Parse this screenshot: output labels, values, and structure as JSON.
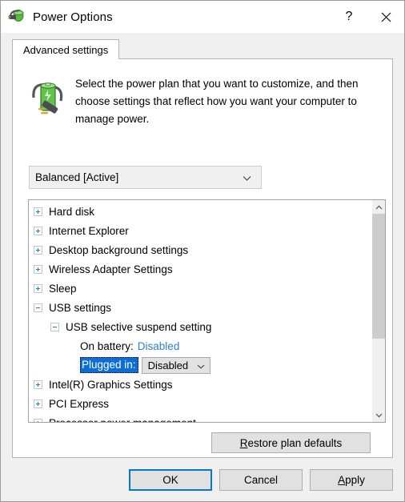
{
  "window": {
    "title": "Power Options",
    "icon": "power-battery-plug-icon",
    "help_label": "?",
    "close_label": "✕"
  },
  "tabs": [
    {
      "label": "Advanced settings",
      "selected": true
    }
  ],
  "header": {
    "icon": "battery-plug-icon",
    "description": "Select the power plan that you want to customize, and then choose settings that reflect how you want your computer to manage power."
  },
  "plan_select": {
    "value": "Balanced [Active]",
    "chevron": "chevron-down-icon"
  },
  "settings_tree": [
    {
      "level": 0,
      "expander": "plus",
      "label": "Hard disk"
    },
    {
      "level": 0,
      "expander": "plus",
      "label": "Internet Explorer"
    },
    {
      "level": 0,
      "expander": "plus",
      "label": "Desktop background settings"
    },
    {
      "level": 0,
      "expander": "plus",
      "label": "Wireless Adapter Settings"
    },
    {
      "level": 0,
      "expander": "plus",
      "label": "Sleep"
    },
    {
      "level": 0,
      "expander": "minus",
      "label": "USB settings"
    },
    {
      "level": 1,
      "expander": "minus",
      "label": "USB selective suspend setting"
    },
    {
      "level": 2,
      "expander": "none",
      "label": "On battery:",
      "value": "Disabled",
      "value_style": "link"
    },
    {
      "level": 2,
      "expander": "none",
      "label": "Plugged in:",
      "value": "Disabled",
      "value_style": "combo",
      "selected": true
    },
    {
      "level": 0,
      "expander": "plus",
      "label": "Intel(R) Graphics Settings"
    },
    {
      "level": 0,
      "expander": "plus",
      "label": "PCI Express"
    },
    {
      "level": 0,
      "expander": "plus",
      "label": "Processor power management"
    }
  ],
  "scrollbar": {
    "up_arrow": "chevron-up-icon",
    "down_arrow": "chevron-down-icon",
    "thumb_position": "top",
    "thumb_fraction": 0.64
  },
  "restore_button": {
    "accel": "R",
    "rest": "estore plan defaults"
  },
  "footer_buttons": [
    {
      "label": "OK",
      "default": true
    },
    {
      "label": "Cancel",
      "default": false
    },
    {
      "label": "Apply",
      "default": false,
      "accel": "A",
      "rest": "pply"
    }
  ],
  "colors": {
    "accent": "#0078d7",
    "selection": "#0b6ed8",
    "link": "#2a7fd0",
    "window_bg": "#f0f0f0",
    "panel_bg": "#ffffff"
  }
}
